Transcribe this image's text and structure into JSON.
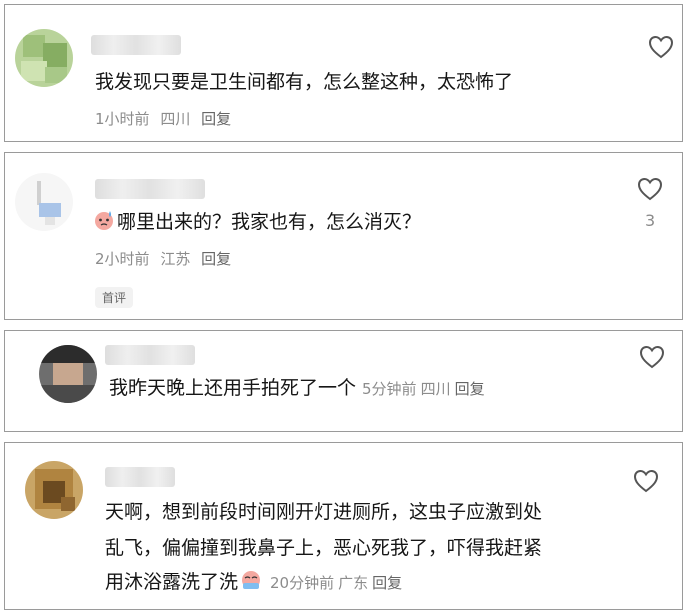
{
  "comments": [
    {
      "text": "我发现只要是卫生间都有，怎么整这种，太恐怖了",
      "time": "1小时前",
      "location": "四川",
      "reply_label": "回复"
    },
    {
      "text": "哪里出来的？我家也有，怎么消灭？",
      "time": "2小时前",
      "location": "江苏",
      "reply_label": "回复",
      "like_count": "3",
      "tag": "首评"
    },
    {
      "text": "我昨天晚上还用手拍死了一个",
      "time": "5分钟前",
      "location": "四川",
      "reply_label": "回复"
    },
    {
      "lines": [
        "天啊，想到前段时间刚开灯进厕所，这虫子应激到处",
        "乱飞，偏偏撞到我鼻子上，恶心死我了，吓得我赶紧",
        "用沐浴露洗了洗"
      ],
      "time": "20分钟前",
      "location": "广东",
      "reply_label": "回复"
    }
  ],
  "icons": {
    "like": "heart-outline-icon",
    "emoji_sweat": "sweat-face-emoji-icon",
    "emoji_crying": "crying-face-emoji-icon"
  },
  "colors": {
    "meta": "#8c8c8c",
    "border": "#9a9a9a",
    "text": "#161616"
  }
}
